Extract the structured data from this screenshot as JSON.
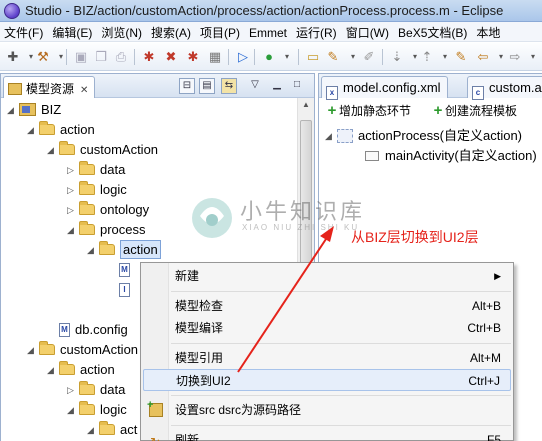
{
  "window": {
    "title": "Studio - BIZ/action/customAction/process/action/actionProcess.process.m - Eclipse"
  },
  "menubar": [
    "文件(F)",
    "编辑(E)",
    "浏览(N)",
    "搜索(A)",
    "项目(P)",
    "Emmet",
    "运行(R)",
    "窗口(W)",
    "BeX5文档(B)",
    "本地"
  ],
  "left_view": {
    "tab_label": "模型资源",
    "tree": [
      {
        "label": "BIZ",
        "depth": 0,
        "expanded": true,
        "icon": "project-icon"
      },
      {
        "label": "action",
        "depth": 1,
        "expanded": true,
        "icon": "folder-icon"
      },
      {
        "label": "customAction",
        "depth": 2,
        "expanded": true,
        "icon": "folder-icon"
      },
      {
        "label": "data",
        "depth": 3,
        "expanded": false,
        "icon": "folder-icon"
      },
      {
        "label": "logic",
        "depth": 3,
        "expanded": false,
        "icon": "folder-icon"
      },
      {
        "label": "ontology",
        "depth": 3,
        "expanded": false,
        "icon": "folder-icon"
      },
      {
        "label": "process",
        "depth": 3,
        "expanded": true,
        "icon": "folder-icon"
      },
      {
        "label": "action",
        "depth": 4,
        "expanded": true,
        "icon": "folder-icon",
        "selected": true
      },
      {
        "label": "",
        "depth": 5,
        "icon": "model-file-icon"
      },
      {
        "label": "",
        "depth": 5,
        "icon": "info-file-icon"
      },
      {
        "label": "",
        "depth": 3,
        "icon": "none"
      },
      {
        "label": "db.config",
        "depth": 2,
        "icon": "model-file-icon"
      },
      {
        "label": "customAction",
        "depth": 1,
        "expanded": true,
        "icon": "folder-icon"
      },
      {
        "label": "action",
        "depth": 2,
        "expanded": true,
        "icon": "folder-icon"
      },
      {
        "label": "data",
        "depth": 3,
        "expanded": false,
        "icon": "folder-icon"
      },
      {
        "label": "logic",
        "depth": 3,
        "expanded": true,
        "icon": "folder-icon"
      },
      {
        "label": "act",
        "depth": 4,
        "expanded": true,
        "icon": "folder-icon"
      },
      {
        "label": "",
        "depth": 5,
        "icon": "model-file-icon"
      }
    ]
  },
  "right_view": {
    "tabs": [
      "model.config.xml",
      "custom.a"
    ],
    "toolbar": {
      "add_static_label": "增加静态环节",
      "create_template_label": "创建流程模板"
    },
    "outline": [
      {
        "label": "actionProcess(自定义action)",
        "depth": 0
      },
      {
        "label": "mainActivity(自定义action)",
        "depth": 1
      }
    ]
  },
  "context_menu": {
    "items": [
      {
        "label": "新建",
        "accel": "",
        "submenu": true
      },
      {
        "separator": true
      },
      {
        "label": "模型检查",
        "accel": "Alt+B"
      },
      {
        "label": "模型编译",
        "accel": "Ctrl+B"
      },
      {
        "separator": true
      },
      {
        "label": "模型引用",
        "accel": "Alt+M"
      },
      {
        "label": "切换到UI2",
        "accel": "Ctrl+J",
        "highlighted": true
      },
      {
        "separator": true
      },
      {
        "label": "设置src dsrc为源码路径",
        "accel": "",
        "icon": true
      },
      {
        "separator": true
      },
      {
        "label": "刷新",
        "accel": "F5"
      }
    ]
  },
  "annotation": {
    "text": "从BIZ层切换到UI2层",
    "color": "#e5231b"
  },
  "watermark": {
    "cn": "小牛知识库",
    "en": "XIAO NIU ZHI SHI KU"
  },
  "colors": {
    "selection": "#d7e6fb",
    "accent": "#7da2d8",
    "annotation_red": "#e5231b"
  }
}
